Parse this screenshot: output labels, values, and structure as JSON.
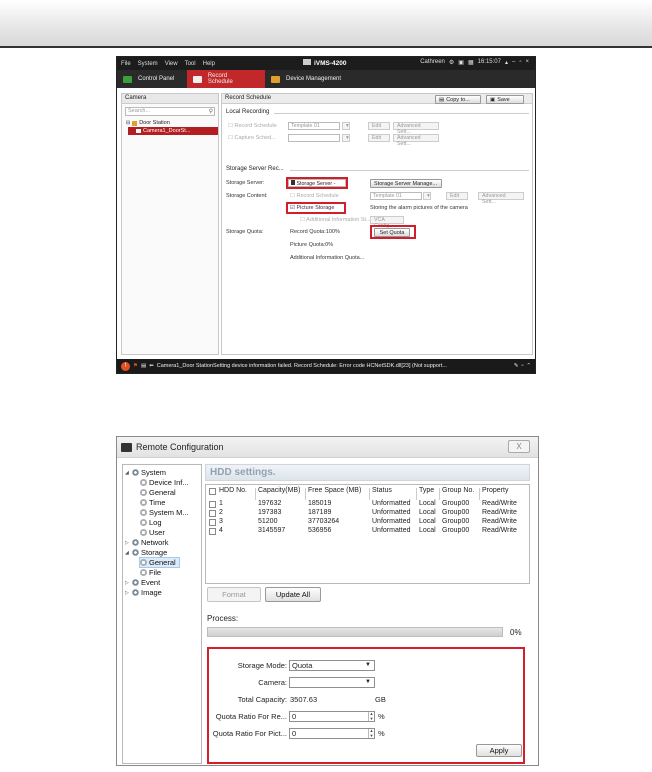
{
  "ivms": {
    "menu": [
      "File",
      "System",
      "View",
      "Tool",
      "Help"
    ],
    "app_title": "iVMS-4200",
    "user": "Cathreen",
    "clock": "16:15:07",
    "tabs": [
      {
        "label": "Control Panel",
        "active": false,
        "icon_color": "#3aa03a"
      },
      {
        "label": "Record Schedule",
        "active": true,
        "icon_color": "#f0f0f0"
      },
      {
        "label": "Device Management",
        "active": false,
        "icon_color": "#e0a030"
      }
    ],
    "camera_panel": {
      "header": "Camera",
      "search_placeholder": "Search...",
      "tree": [
        "Door Station",
        "Camera1_DoorSt..."
      ]
    },
    "main": {
      "header": "Record Schedule",
      "copy_to": "Copy to...",
      "save": "Save",
      "local_recording": "Local Recording",
      "record_schedule": "Record Schedule",
      "template": "Template 01",
      "edit": "Edit",
      "advanced": "Advanced Sett...",
      "capture_schedule": "Capture Sched...",
      "storage_server_section": "Storage Server Rec...",
      "storage_server_label": "Storage Server:",
      "storage_server_value": "Storage Server -",
      "storage_server_manage": "Storage Server Manage...",
      "storage_content_label": "Storage Content:",
      "record_schedule_opt": "Record Schedule",
      "template_2": "Template 01",
      "edit_2": "Edit",
      "advanced_2": "Advanced Sett...",
      "picture_storage": "Picture Storage",
      "picture_storage_note": "Storing the alarm pictures of the camera",
      "additional_info": "Additional Information St...",
      "vca_config": "VCA Config",
      "storage_quota_label": "Storage Quota:",
      "record_quota": "Record Quota:100%",
      "set_quota": "Set Quota",
      "picture_quota": "Picture Quota:0%",
      "additional_quota": "Additional Information Quota..."
    },
    "status_message": "Camera1_Door StationSetting device information failed. Record Schedule: Error code HCNetSDK.dll[23] (Not support..."
  },
  "remote_config": {
    "title": "Remote Configuration",
    "close": "X",
    "tree": {
      "system": "System",
      "device_info": "Device Inf...",
      "general": "General",
      "time": "Time",
      "system_m": "System M...",
      "log": "Log",
      "user": "User",
      "network": "Network",
      "storage": "Storage",
      "storage_general": "General",
      "file": "File",
      "event": "Event",
      "image": "Image"
    },
    "hdd_title": "HDD settings.",
    "columns": [
      "HDD No.",
      "Capacity(MB)",
      "Free Space (MB)",
      "Status",
      "Type",
      "Group No.",
      "Property"
    ],
    "rows": [
      [
        "1",
        "197632",
        "185019",
        "Unformatted",
        "Local",
        "Group00",
        "Read/Write"
      ],
      [
        "2",
        "197383",
        "187189",
        "Unformatted",
        "Local",
        "Group00",
        "Read/Write"
      ],
      [
        "3",
        "51200",
        "37703264",
        "Unformatted",
        "Local",
        "Group00",
        "Read/Write"
      ],
      [
        "4",
        "3145597",
        "536956",
        "Unformatted",
        "Local",
        "Group00",
        "Read/Write"
      ]
    ],
    "format_btn": "Format",
    "update_all_btn": "Update All",
    "process_label": "Process:",
    "process_percent": "0%",
    "process_fraction": 0,
    "storage_mode_label": "Storage Mode:",
    "storage_mode_value": "Quota",
    "camera_label": "Camera:",
    "camera_value": "",
    "total_capacity_label": "Total Capacity:",
    "total_capacity_value": "3507.63",
    "total_capacity_unit": "GB",
    "quota_record_label": "Quota Ratio For Re...",
    "quota_record_value": "0",
    "quota_picture_label": "Quota Ratio For Pict...",
    "quota_picture_value": "0",
    "percent_unit": "%",
    "apply_btn": "Apply"
  },
  "colors": {
    "accent_red": "#c2282a",
    "highlight_box": "#d01f2a",
    "progress_green": "#4ea04e"
  }
}
